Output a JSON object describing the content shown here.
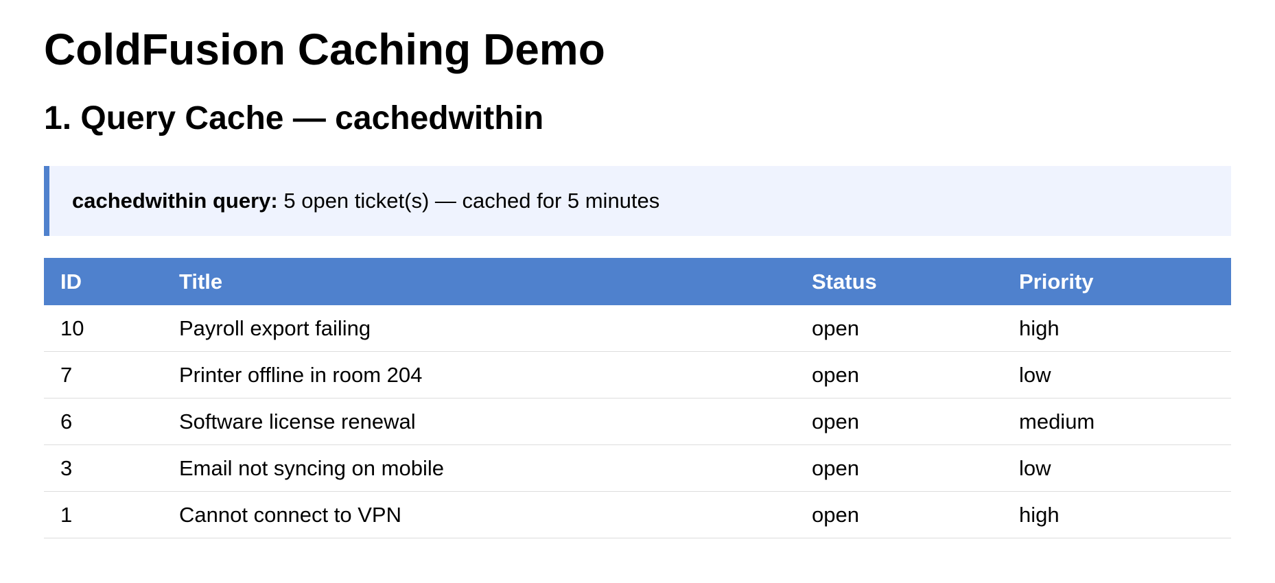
{
  "page": {
    "title": "ColdFusion Caching Demo"
  },
  "section1": {
    "title": "1. Query Cache — cachedwithin",
    "info": {
      "label": "cachedwithin query:",
      "text": "5 open ticket(s) — cached for 5 minutes"
    }
  },
  "table": {
    "headers": {
      "id": "ID",
      "title": "Title",
      "status": "Status",
      "priority": "Priority"
    },
    "rows": [
      {
        "id": "10",
        "title": "Payroll export failing",
        "status": "open",
        "priority": "high"
      },
      {
        "id": "7",
        "title": "Printer offline in room 204",
        "status": "open",
        "priority": "low"
      },
      {
        "id": "6",
        "title": "Software license renewal",
        "status": "open",
        "priority": "medium"
      },
      {
        "id": "3",
        "title": "Email not syncing on mobile",
        "status": "open",
        "priority": "low"
      },
      {
        "id": "1",
        "title": "Cannot connect to VPN",
        "status": "open",
        "priority": "high"
      }
    ]
  },
  "colors": {
    "accent": "#4f81cd",
    "info_background": "#eff3fe",
    "row_divider": "#dddddd"
  }
}
